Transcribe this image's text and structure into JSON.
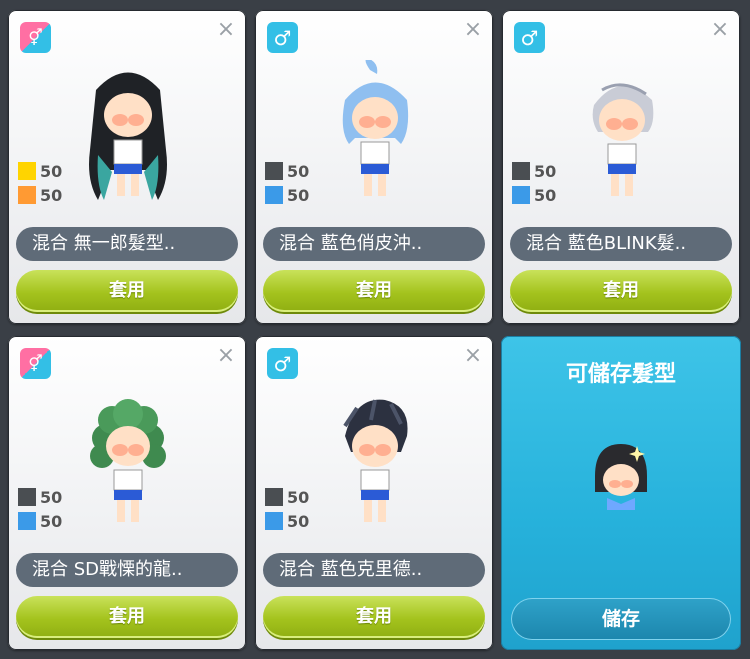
{
  "cards": [
    {
      "gender_icon": "unisex-icon",
      "gender_glyph": "⚥",
      "name": "混合 無一郎髮型..",
      "apply_label": "套用",
      "colors": [
        {
          "hex": "#ffd400",
          "value": "50"
        },
        {
          "hex": "#ff9a33",
          "value": "50"
        }
      ]
    },
    {
      "gender_icon": "male-icon",
      "gender_glyph": "♂",
      "name": "混合 藍色俏皮沖..",
      "apply_label": "套用",
      "colors": [
        {
          "hex": "#4a4e52",
          "value": "50"
        },
        {
          "hex": "#3b9ae8",
          "value": "50"
        }
      ]
    },
    {
      "gender_icon": "male-icon",
      "gender_glyph": "♂",
      "name": "混合 藍色BLINK髮..",
      "apply_label": "套用",
      "colors": [
        {
          "hex": "#4a4e52",
          "value": "50"
        },
        {
          "hex": "#3b9ae8",
          "value": "50"
        }
      ]
    },
    {
      "gender_icon": "unisex-icon",
      "gender_glyph": "⚥",
      "name": "混合 SD戰慄的龍..",
      "apply_label": "套用",
      "colors": [
        {
          "hex": "#4a4e52",
          "value": "50"
        },
        {
          "hex": "#3b9ae8",
          "value": "50"
        }
      ]
    },
    {
      "gender_icon": "male-icon",
      "gender_glyph": "♂",
      "name": "混合 藍色克里德..",
      "apply_label": "套用",
      "colors": [
        {
          "hex": "#4a4e52",
          "value": "50"
        },
        {
          "hex": "#3b9ae8",
          "value": "50"
        }
      ]
    }
  ],
  "save_panel": {
    "title": "可儲存髮型",
    "button_label": "儲存"
  },
  "close_glyph": "×"
}
